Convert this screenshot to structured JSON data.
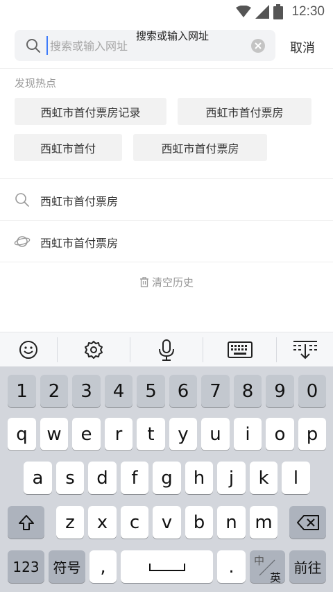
{
  "status_bar": {
    "time": "12:30",
    "icons": [
      "wifi-icon",
      "cell-signal-icon",
      "battery-icon"
    ]
  },
  "search": {
    "placeholder": "搜索或输入网址",
    "tooltip": "搜索或输入网址",
    "cancel_label": "取消"
  },
  "hot": {
    "title": "发现热点",
    "chips": [
      "西虹市首付票房记录",
      "西虹市首付票房",
      "西虹市首付",
      "西虹市首付票房"
    ]
  },
  "history": {
    "items": [
      {
        "icon": "search-icon",
        "text": "西虹市首付票房"
      },
      {
        "icon": "planet-icon",
        "text": "西虹市首付票房"
      }
    ],
    "clear_label": "清空历史"
  },
  "keyboard": {
    "toolbar": [
      "emoji-icon",
      "settings-icon",
      "microphone-icon",
      "keyboard-icon",
      "collapse-keyboard-icon"
    ],
    "number_row": [
      "1",
      "2",
      "3",
      "4",
      "5",
      "6",
      "7",
      "8",
      "9",
      "0"
    ],
    "row1": [
      "q",
      "w",
      "e",
      "r",
      "t",
      "y",
      "u",
      "i",
      "o",
      "p"
    ],
    "row2": [
      "a",
      "s",
      "d",
      "f",
      "g",
      "h",
      "j",
      "k",
      "l"
    ],
    "row3": [
      "z",
      "x",
      "c",
      "v",
      "b",
      "n",
      "m"
    ],
    "bottom": {
      "num_label": "123",
      "symbol_label": "符号",
      "comma": ",",
      "period": ".",
      "lang_zh": "中",
      "lang_en": "英",
      "go_label": "前往"
    }
  }
}
